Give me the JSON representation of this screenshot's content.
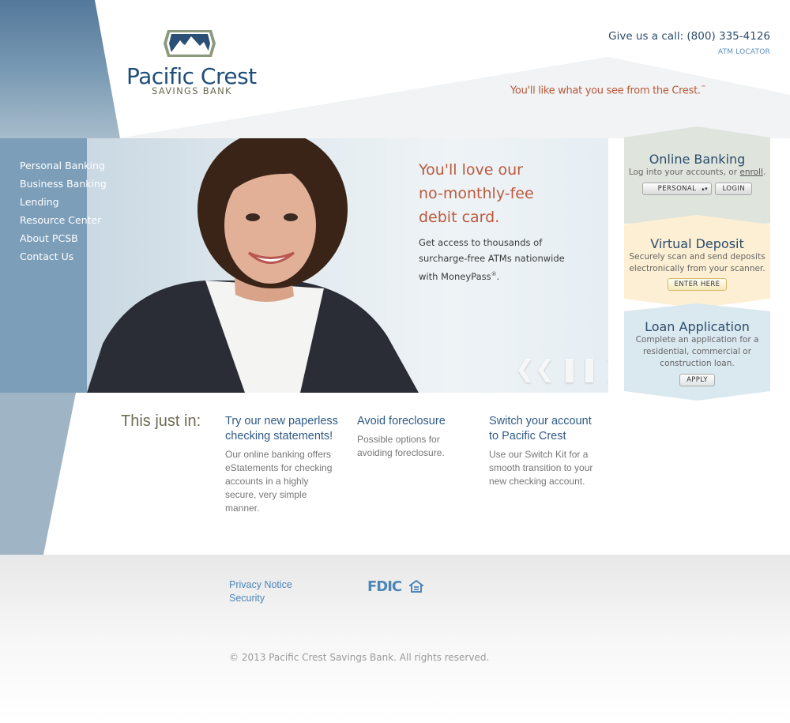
{
  "header": {
    "brand_name": "Pacific Crest",
    "brand_sub": "SAVINGS BANK",
    "call_label": "Give us a call: ",
    "phone": "(800) 335-4126",
    "atm_locator": "ATM LOCATOR",
    "tagline": "You'll like what you see from the Crest.",
    "tagline_mark": "™"
  },
  "nav": [
    {
      "label": "Personal Banking"
    },
    {
      "label": "Business Banking"
    },
    {
      "label": "Lending"
    },
    {
      "label": "Resource Center"
    },
    {
      "label": "About PCSB"
    },
    {
      "label": "Contact Us"
    }
  ],
  "hero": {
    "heading_line1": "You'll love our",
    "heading_line2": "no-monthly-fee",
    "heading_line3": "debit card.",
    "text_line1": "Get access to thousands of",
    "text_line2": "surcharge-free ATMs nationwide",
    "text_line3": "with MoneyPass",
    "text_mark": "®",
    "text_end": ".",
    "prev": "❮❮",
    "pause": "❚❚",
    "next": "❯❯"
  },
  "online_banking": {
    "title": "Online Banking",
    "text": "Log into your accounts, or ",
    "enroll": "enroll",
    "period": ".",
    "select_value": "PERSONAL",
    "login": "LOGIN"
  },
  "virtual_deposit": {
    "title": "Virtual Deposit",
    "text_line1": "Securely scan and send deposits",
    "text_line2": "electronically from your scanner.",
    "button": "ENTER HERE"
  },
  "loan_application": {
    "title": "Loan Application",
    "text_line1": "Complete an application for a",
    "text_line2": "residential, commercial or",
    "text_line3": "construction loan.",
    "button": "APPLY"
  },
  "news": {
    "label": "This just in:",
    "items": [
      {
        "title": "Try our new paperless checking statements!",
        "body": "Our online banking offers eStatements for checking accounts in a highly secure, very simple manner."
      },
      {
        "title": "Avoid foreclosure",
        "body": "Possible options for avoiding foreclosure."
      },
      {
        "title": "Switch your account to Pacific Crest",
        "body": "Use our Switch Kit for a smooth transition to your new checking account."
      }
    ]
  },
  "footer": {
    "privacy": "Privacy Notice",
    "security": "Security",
    "fdic": "FDIC",
    "copyright": "© 2013 Pacific Crest Savings Bank. All rights reserved."
  },
  "colors": {
    "brand_blue": "#1f4d7a",
    "accent_orange": "#bb5a3c",
    "side_band": "#5b82a3",
    "online_panel": "#dde3dc",
    "virtual_panel": "#fbeed2",
    "loan_panel": "#d9e8f1"
  }
}
